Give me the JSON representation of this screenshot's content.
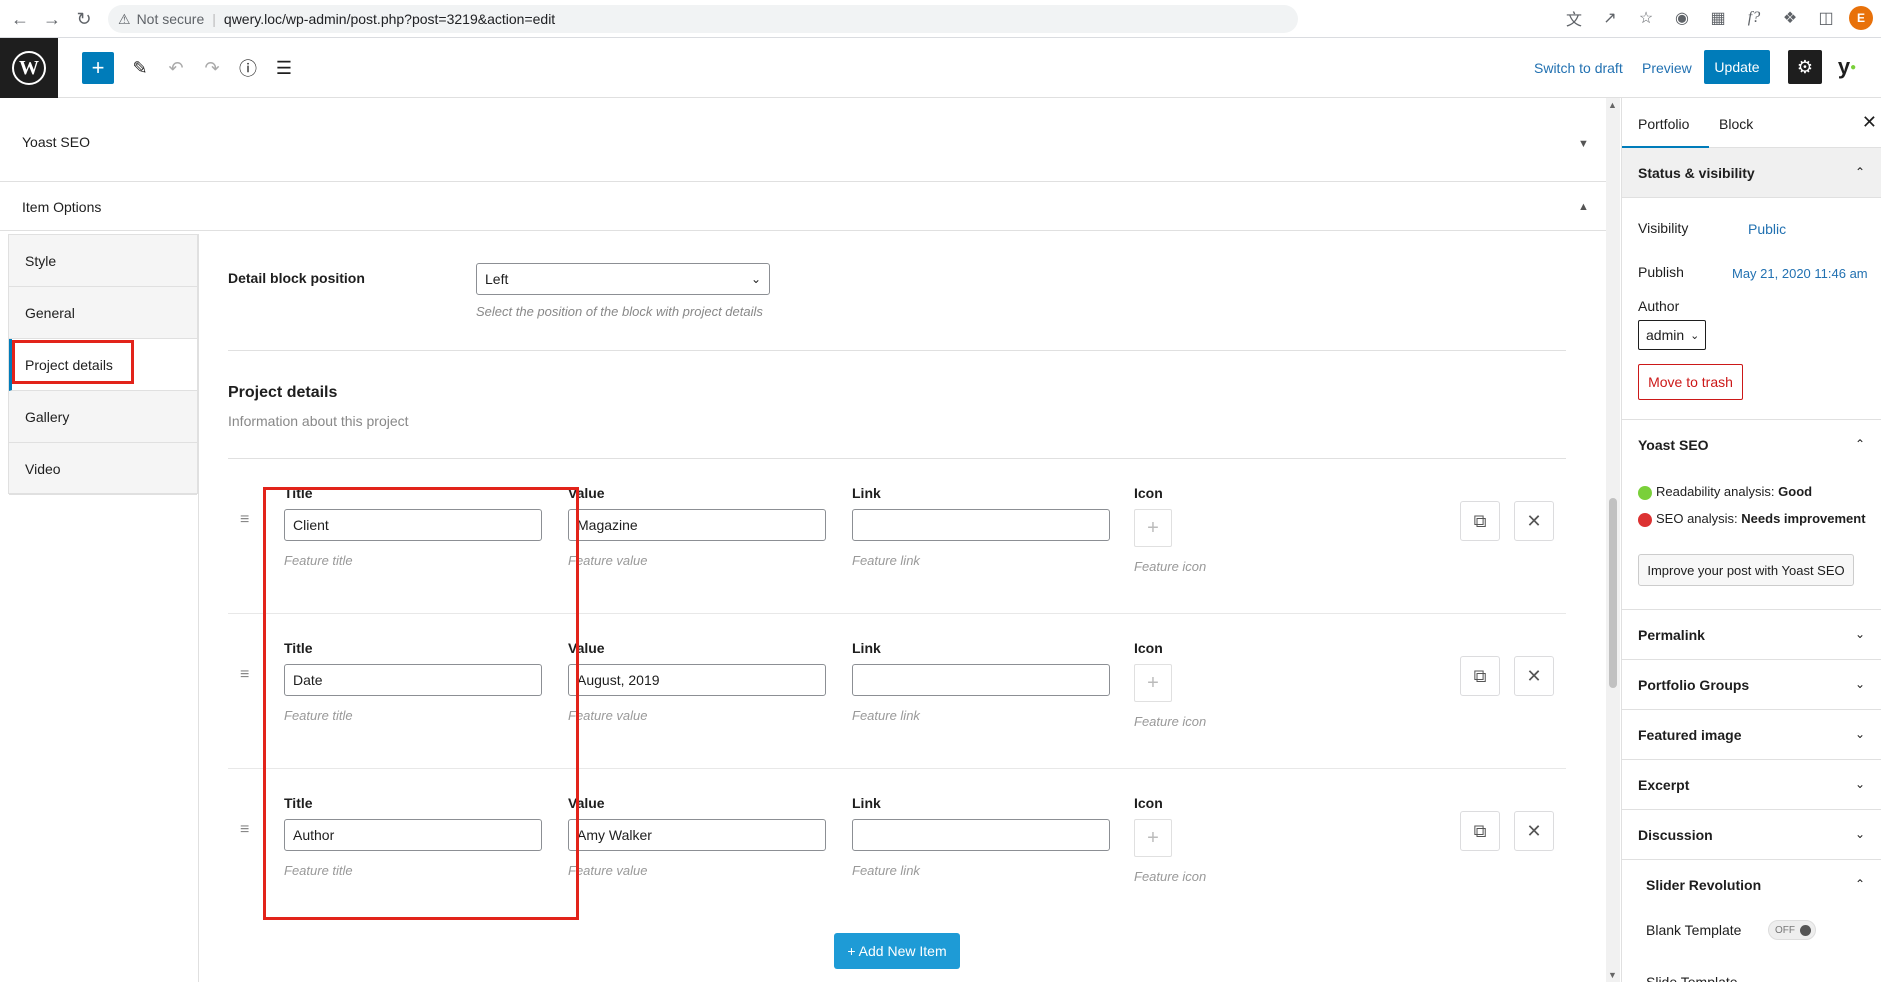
{
  "browser": {
    "security_label": "Not secure",
    "url": "qwery.loc/wp-admin/post.php?post=3219&action=edit",
    "profile_initial": "E"
  },
  "toolbar": {
    "switch_to_draft": "Switch to draft",
    "preview": "Preview",
    "update": "Update"
  },
  "panels": {
    "yoast_seo": "Yoast SEO",
    "item_options": "Item Options"
  },
  "item_tabs": [
    "Style",
    "General",
    "Project details",
    "Gallery",
    "Video"
  ],
  "detail_block": {
    "label": "Detail block position",
    "value": "Left",
    "hint": "Select the position of the block with project details"
  },
  "project_details": {
    "title": "Project details",
    "subtitle": "Information about this project",
    "labels": {
      "title": "Title",
      "value": "Value",
      "link": "Link",
      "icon": "Icon"
    },
    "hints": {
      "title": "Feature title",
      "value": "Feature value",
      "link": "Feature link",
      "icon": "Feature icon"
    },
    "rows": [
      {
        "title": "Client",
        "value": "Magazine",
        "link": ""
      },
      {
        "title": "Date",
        "value": "August, 2019",
        "link": ""
      },
      {
        "title": "Author",
        "value": "Amy Walker",
        "link": ""
      }
    ],
    "add_button": "+ Add New Item"
  },
  "sidebar": {
    "tabs": [
      "Portfolio",
      "Block"
    ],
    "status_visibility": {
      "heading": "Status & visibility",
      "visibility_label": "Visibility",
      "visibility_value": "Public",
      "publish_label": "Publish",
      "publish_value": "May 21, 2020 11:46 am",
      "author_label": "Author",
      "author_value": "admin",
      "trash_button": "Move to trash"
    },
    "yoast": {
      "heading": "Yoast SEO",
      "readability_label": "Readability analysis:",
      "readability_value": "Good",
      "seo_label": "SEO analysis:",
      "seo_value": "Needs improvement",
      "improve_button": "Improve your post with Yoast SEO"
    },
    "sections": [
      "Permalink",
      "Portfolio Groups",
      "Featured image",
      "Excerpt",
      "Discussion"
    ],
    "slider_revolution": {
      "heading": "Slider Revolution",
      "blank_template_label": "Blank Template",
      "toggle_value": "OFF",
      "slide_template_label": "Slide Template"
    }
  },
  "colors": {
    "accent": "#007cba",
    "highlight_box": "#e2231a",
    "good": "#7ad03a",
    "bad": "#dc3232"
  }
}
